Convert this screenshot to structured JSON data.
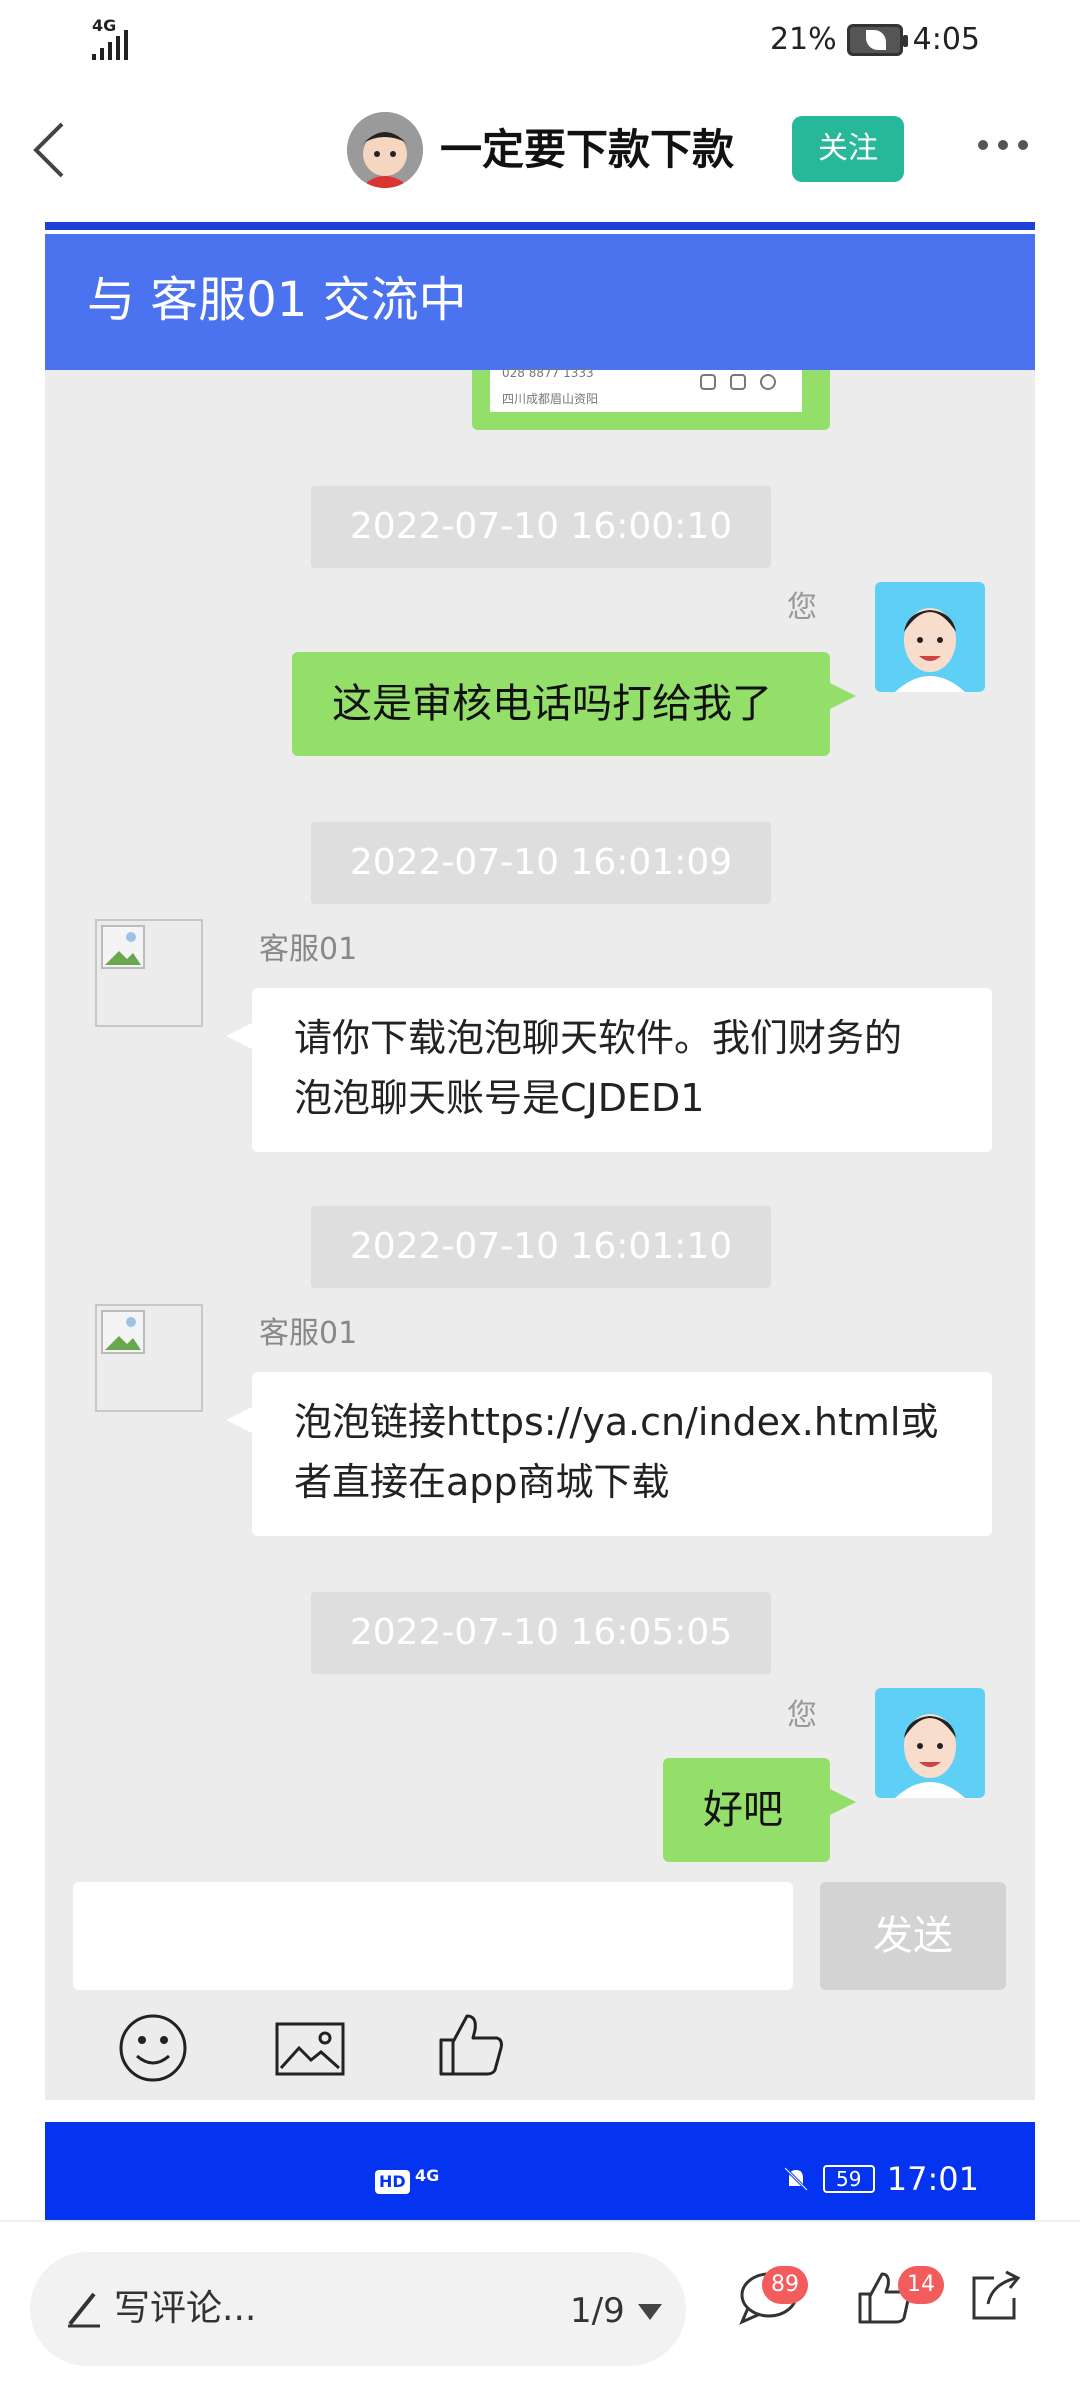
{
  "status_bar": {
    "network": "4G",
    "battery_percent": "21%",
    "time": "4:05"
  },
  "post_header": {
    "author_name": "一定要下款下款",
    "follow_label": "关注"
  },
  "screenshot": {
    "chat_title": "与 客服01 交流中",
    "card_snippet": {
      "phone": "028 8877 1333",
      "address": "四川成都眉山资阳"
    },
    "messages": [
      {
        "type": "timestamp",
        "text": "2022-07-10 16:00:10"
      },
      {
        "type": "outgoing",
        "sender": "您",
        "text": "这是审核电话吗打给我了"
      },
      {
        "type": "timestamp",
        "text": "2022-07-10 16:01:09"
      },
      {
        "type": "incoming",
        "sender": "客服01",
        "line1": "请你下载泡泡聊天软件。我们财务的",
        "line2": "泡泡聊天账号是CJDED1"
      },
      {
        "type": "timestamp",
        "text": "2022-07-10 16:01:10"
      },
      {
        "type": "incoming",
        "sender": "客服01",
        "line1": "泡泡链接https://ya.cn/index.html或",
        "line2": "者直接在app商城下载"
      },
      {
        "type": "timestamp",
        "text": "2022-07-10 16:05:05"
      },
      {
        "type": "outgoing",
        "sender": "您",
        "text": "好吧"
      }
    ],
    "send_label": "发送",
    "inner_status": {
      "hd": "HD",
      "network": "4G",
      "battery": "59",
      "time": "17:01"
    }
  },
  "bottom_bar": {
    "comment_placeholder": "写评论...",
    "page_indicator": "1/9",
    "comment_count": "89",
    "like_count": "14"
  },
  "colors": {
    "follow": "#27b89a",
    "chat_header": "#4b73ef",
    "green_bubble": "#94df6a",
    "badge": "#f25c5c"
  }
}
